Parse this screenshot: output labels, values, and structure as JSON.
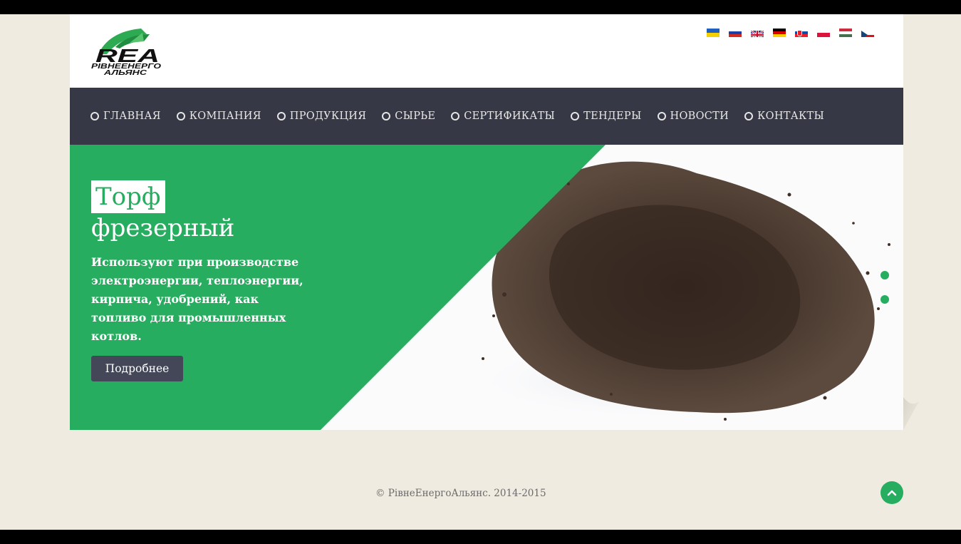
{
  "logo": {
    "letters": "REA",
    "line1": "РІВНЕЕНЕРГО",
    "line2": "АЛЬЯНС"
  },
  "languages": [
    {
      "code": "ua",
      "flag": "ukraine-flag"
    },
    {
      "code": "ru",
      "flag": "russia-flag"
    },
    {
      "code": "en",
      "flag": "uk-flag"
    },
    {
      "code": "de",
      "flag": "germany-flag"
    },
    {
      "code": "sk",
      "flag": "slovakia-flag"
    },
    {
      "code": "pl",
      "flag": "poland-flag"
    },
    {
      "code": "hu",
      "flag": "hungary-flag"
    },
    {
      "code": "cz",
      "flag": "czech-flag"
    }
  ],
  "nav": {
    "items": [
      "ГЛАВНАЯ",
      "КОМПАНИЯ",
      "ПРОДУКЦИЯ",
      "СЫРЬЕ",
      "СЕРТИФИКАТЫ",
      "ТЕНДЕРЫ",
      "НОВОСТИ",
      "КОНТАКТЫ"
    ]
  },
  "hero": {
    "title_highlight": "Торф",
    "title_rest": "фрезерный",
    "description": "Используют при производстве электроэнергии, теплоэнергии, кирпича, удобрений, как топливо для промышленных котлов.",
    "button_label": "Подробнее",
    "slides": 2
  },
  "footer": {
    "copyright": "© РівнеЕнергоАльянс. 2014-2015"
  },
  "colors": {
    "accent": "#27ad5f",
    "nav_bg": "#373845",
    "page_bg": "#efebe1",
    "button_bg": "#434758"
  },
  "icons": {
    "back_to_top": "chevron-up-icon",
    "nav_bullet": "circle-outline-icon"
  }
}
